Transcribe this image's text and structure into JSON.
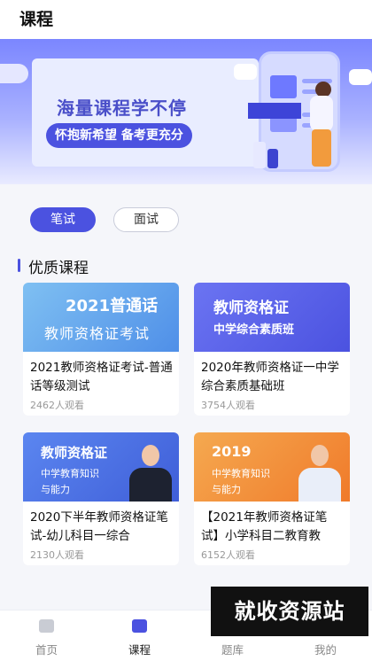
{
  "header": {
    "title": "课程"
  },
  "banner": {
    "heading": "海量课程学不停",
    "slogan": "怀抱新希望 备考更充分"
  },
  "tabs": [
    {
      "label": "笔试",
      "active": true
    },
    {
      "label": "面试",
      "active": false
    }
  ],
  "section": {
    "title": "优质课程"
  },
  "courses": [
    {
      "thumb_line1": "2021普通话",
      "thumb_line2": "教师资格证考试",
      "name": "2021教师资格证考试-普通话等级测试",
      "views": "2462人观看"
    },
    {
      "thumb_line1": "教师资格证",
      "thumb_line2": "中学综合素质班",
      "name": "2020年教师资格证一中学综合素质基础班",
      "views": "3754人观看"
    },
    {
      "thumb_line1": "教师资格证",
      "thumb_line2": "中学教育知识",
      "thumb_line3": "与能力",
      "name": "2020下半年教师资格证笔试-幼儿科目一综合",
      "views": "2130人观看"
    },
    {
      "thumb_line1": "2019",
      "thumb_line2": "中学教育知识",
      "thumb_line3": "与能力",
      "name": "【2021年教师资格证笔试】小学科目二教育教",
      "views": "6152人观看"
    }
  ],
  "tabbar": [
    {
      "label": "首页",
      "active": false
    },
    {
      "label": "课程",
      "active": true
    },
    {
      "label": "题库",
      "active": false
    },
    {
      "label": "我的",
      "active": false
    }
  ],
  "watermark": "就收资源站",
  "colors": {
    "accent": "#4b52e0",
    "muted": "#999999"
  }
}
